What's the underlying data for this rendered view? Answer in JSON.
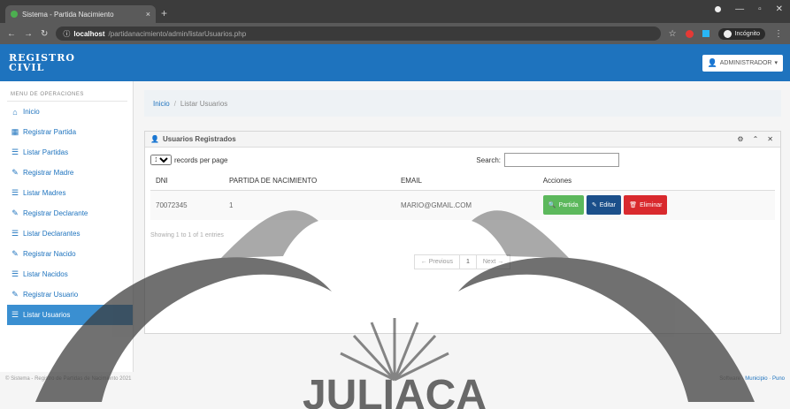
{
  "browser": {
    "tab_title": "Sistema - Partida Nacimiento",
    "tab_close": "×",
    "new_tab": "+",
    "url_host": "localhost",
    "url_path": "/partidanacimiento/admin/listarUsuarios.php",
    "incognito_label": "Incógnito"
  },
  "header": {
    "brand_line1": "REGISTRO",
    "brand_line2": "CIVIL",
    "user_label": "ADMINISTRADOR"
  },
  "sidebar": {
    "heading": "MENU DE OPERACIONES",
    "items": [
      {
        "label": "Inicio",
        "icon": "home-icon"
      },
      {
        "label": "Registrar Partida",
        "icon": "table-icon"
      },
      {
        "label": "Listar Partidas",
        "icon": "list-icon"
      },
      {
        "label": "Registrar Madre",
        "icon": "edit-icon"
      },
      {
        "label": "Listar Madres",
        "icon": "list-icon"
      },
      {
        "label": "Registrar Declarante",
        "icon": "edit-icon"
      },
      {
        "label": "Listar Declarantes",
        "icon": "list-icon"
      },
      {
        "label": "Registrar Nacido",
        "icon": "edit-icon"
      },
      {
        "label": "Listar Nacidos",
        "icon": "list-icon"
      },
      {
        "label": "Registrar Usuario",
        "icon": "edit-icon"
      },
      {
        "label": "Listar Usuarios",
        "icon": "list-icon"
      }
    ]
  },
  "breadcrumb": {
    "home": "Inicio",
    "sep": "/",
    "current": "Listar Usuarios"
  },
  "panel": {
    "title": "Usuarios Registrados",
    "length_value": "10",
    "length_suffix": "records per page",
    "search_label": "Search:",
    "columns": [
      "DNI",
      "PARTIDA DE NACIMIENTO",
      "EMAIL",
      "Acciones"
    ],
    "rows": [
      {
        "dni": "70072345",
        "partida": "1",
        "email": "MARIO@GMAIL.COM"
      }
    ],
    "actions": {
      "view": "Partida",
      "edit": "Editar",
      "delete": "Eliminar"
    },
    "info": "Showing 1 to 1 of 1 entries",
    "pager": {
      "prev": "← Previous",
      "page": "1",
      "next": "Next →"
    }
  },
  "footer": {
    "left": "© Sistema - Registro de Partidas de Nacimiento 2021",
    "right_prefix": "Software · ",
    "right_link": "Municipio · Puno"
  },
  "watermark": {
    "text": "JULIACA"
  },
  "colors": {
    "primary": "#1e73be",
    "green": "#5cb85c",
    "navy": "#1b4f8a",
    "red": "#d9292d"
  }
}
